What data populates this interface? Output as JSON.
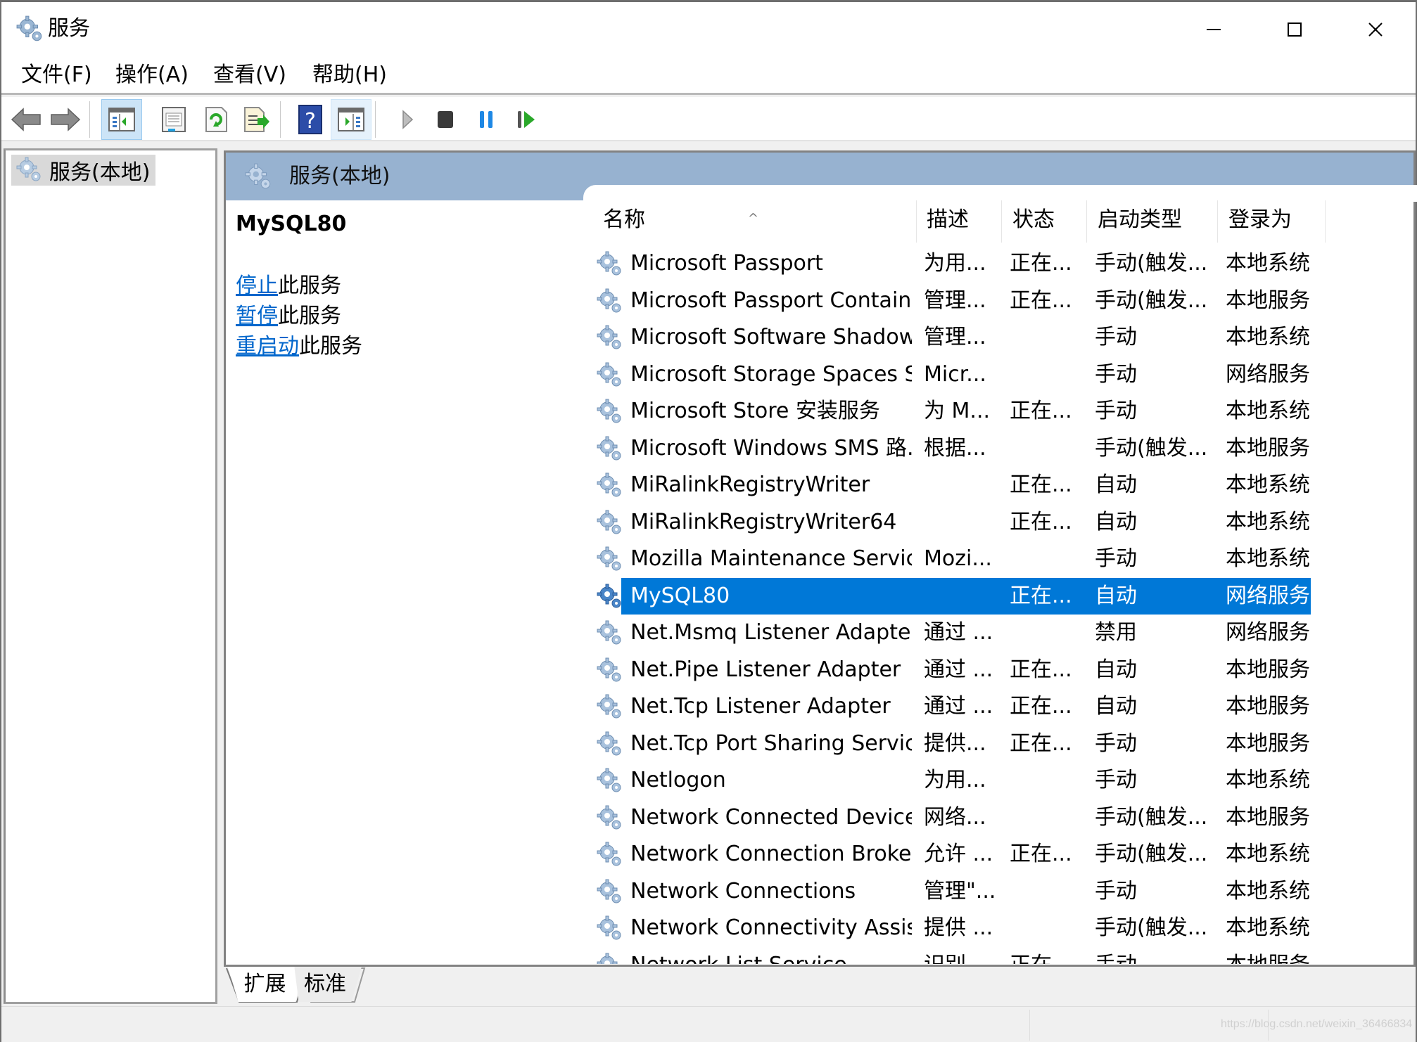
{
  "window": {
    "title": "服务",
    "controls": {
      "minimize": "minimize",
      "maximize": "maximize",
      "close": "close"
    }
  },
  "menu": [
    {
      "label": "文件(F)"
    },
    {
      "label": "操作(A)"
    },
    {
      "label": "查看(V)"
    },
    {
      "label": "帮助(H)"
    }
  ],
  "toolbar": {
    "buttons": [
      {
        "icon": "back-arrow-icon",
        "label": "Back"
      },
      {
        "icon": "forward-arrow-icon",
        "label": "Forward"
      },
      {
        "icon": "show-hide-console-tree-icon",
        "label": "Show/Hide Console Tree",
        "active": true
      },
      {
        "icon": "properties-icon",
        "label": "Properties"
      },
      {
        "icon": "refresh-icon",
        "label": "Refresh"
      },
      {
        "icon": "export-list-icon",
        "label": "Export List"
      },
      {
        "icon": "help-icon",
        "label": "Help"
      },
      {
        "icon": "show-hide-action-pane-icon",
        "label": "Show/Hide Action Pane",
        "active": true
      },
      {
        "icon": "start-service-icon",
        "label": "Start Service"
      },
      {
        "icon": "stop-service-icon",
        "label": "Stop Service"
      },
      {
        "icon": "pause-service-icon",
        "label": "Pause Service"
      },
      {
        "icon": "restart-service-icon",
        "label": "Restart Service"
      }
    ]
  },
  "tree": {
    "root_label": "服务(本地)"
  },
  "pane": {
    "header": "服务(本地)",
    "selected_service": "MySQL80",
    "actions": [
      {
        "link": "停止",
        "suffix": "此服务"
      },
      {
        "link": "暂停",
        "suffix": "此服务"
      },
      {
        "link": "重启动",
        "suffix": "此服务"
      }
    ]
  },
  "list": {
    "columns": {
      "name": "名称",
      "description": "描述",
      "status": "状态",
      "startup_type": "启动类型",
      "log_on_as": "登录为"
    },
    "sort_indicator": "^",
    "rows": [
      {
        "name": "Microsoft Passport",
        "description": "为用...",
        "status": "正在...",
        "startup": "手动(触发...",
        "logon": "本地系统"
      },
      {
        "name": "Microsoft Passport Container",
        "description": "管理...",
        "status": "正在...",
        "startup": "手动(触发...",
        "logon": "本地服务"
      },
      {
        "name": "Microsoft Software Shadow...",
        "description": "管理...",
        "status": "",
        "startup": "手动",
        "logon": "本地系统"
      },
      {
        "name": "Microsoft Storage Spaces S...",
        "description": "Micr...",
        "status": "",
        "startup": "手动",
        "logon": "网络服务"
      },
      {
        "name": "Microsoft Store 安装服务",
        "description": "为 M...",
        "status": "正在...",
        "startup": "手动",
        "logon": "本地系统"
      },
      {
        "name": "Microsoft Windows SMS 路...",
        "description": "根据...",
        "status": "",
        "startup": "手动(触发...",
        "logon": "本地服务"
      },
      {
        "name": "MiRalinkRegistryWriter",
        "description": "",
        "status": "正在...",
        "startup": "自动",
        "logon": "本地系统"
      },
      {
        "name": "MiRalinkRegistryWriter64",
        "description": "",
        "status": "正在...",
        "startup": "自动",
        "logon": "本地系统"
      },
      {
        "name": "Mozilla Maintenance Service",
        "description": "Mozi...",
        "status": "",
        "startup": "手动",
        "logon": "本地系统"
      },
      {
        "name": "MySQL80",
        "description": "",
        "status": "正在...",
        "startup": "自动",
        "logon": "网络服务",
        "selected": true
      },
      {
        "name": "Net.Msmq Listener Adapter",
        "description": "通过 ...",
        "status": "",
        "startup": "禁用",
        "logon": "网络服务"
      },
      {
        "name": "Net.Pipe Listener Adapter",
        "description": "通过 ...",
        "status": "正在...",
        "startup": "自动",
        "logon": "本地服务"
      },
      {
        "name": "Net.Tcp Listener Adapter",
        "description": "通过 ...",
        "status": "正在...",
        "startup": "自动",
        "logon": "本地服务"
      },
      {
        "name": "Net.Tcp Port Sharing Service",
        "description": "提供...",
        "status": "正在...",
        "startup": "手动",
        "logon": "本地服务"
      },
      {
        "name": "Netlogon",
        "description": "为用...",
        "status": "",
        "startup": "手动",
        "logon": "本地系统"
      },
      {
        "name": "Network Connected Device...",
        "description": "网络...",
        "status": "",
        "startup": "手动(触发...",
        "logon": "本地服务"
      },
      {
        "name": "Network Connection Broker",
        "description": "允许 ...",
        "status": "正在...",
        "startup": "手动(触发...",
        "logon": "本地系统"
      },
      {
        "name": "Network Connections",
        "description": "管理\"...",
        "status": "",
        "startup": "手动",
        "logon": "本地系统"
      },
      {
        "name": "Network Connectivity Assis...",
        "description": "提供 ...",
        "status": "",
        "startup": "手动(触发...",
        "logon": "本地系统"
      },
      {
        "name": "Network List Service",
        "description": "识别...",
        "status": "正在...",
        "startup": "手动",
        "logon": "本地服务"
      }
    ]
  },
  "tabs": [
    {
      "label": "扩展",
      "active": true
    },
    {
      "label": "标准",
      "active": false
    }
  ],
  "status_bar": {
    "watermark": "https://blog.csdn.net/weixin_36466834"
  },
  "colors": {
    "selection": "#0078d7",
    "header_band": "#97b2d0",
    "link": "#0066cc"
  }
}
